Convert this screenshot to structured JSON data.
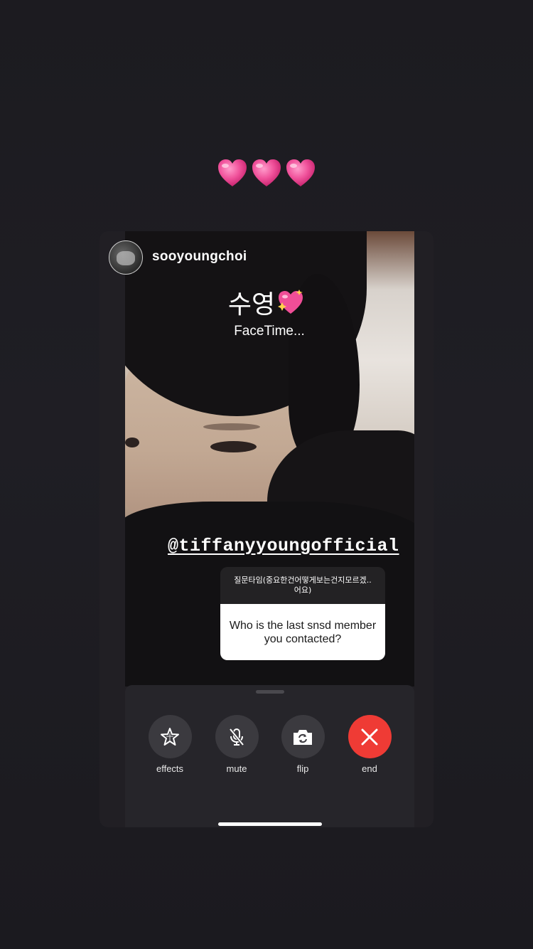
{
  "decor": {
    "hearts_icon": "pink-heart-icon",
    "hearts_count": 3,
    "heart_color": "#f0529b"
  },
  "story": {
    "username": "sooyoungchoi",
    "caller_name": "수영",
    "caller_emoji": "sparkling-heart-icon",
    "call_status": "FaceTime...",
    "mention": "@tiffanyyoungofficial"
  },
  "question": {
    "prompt": "질문타임(중요한건어떻게보는건지모르겠..어요)",
    "answer": "Who is the last snsd member  you contacted?"
  },
  "controls": {
    "effects": {
      "label": "effects",
      "icon": "star-icon"
    },
    "mute": {
      "label": "mute",
      "icon": "mic-slash-icon"
    },
    "flip": {
      "label": "flip",
      "icon": "camera-flip-icon"
    },
    "end": {
      "label": "end",
      "icon": "close-icon",
      "color": "#ef3b35"
    }
  }
}
